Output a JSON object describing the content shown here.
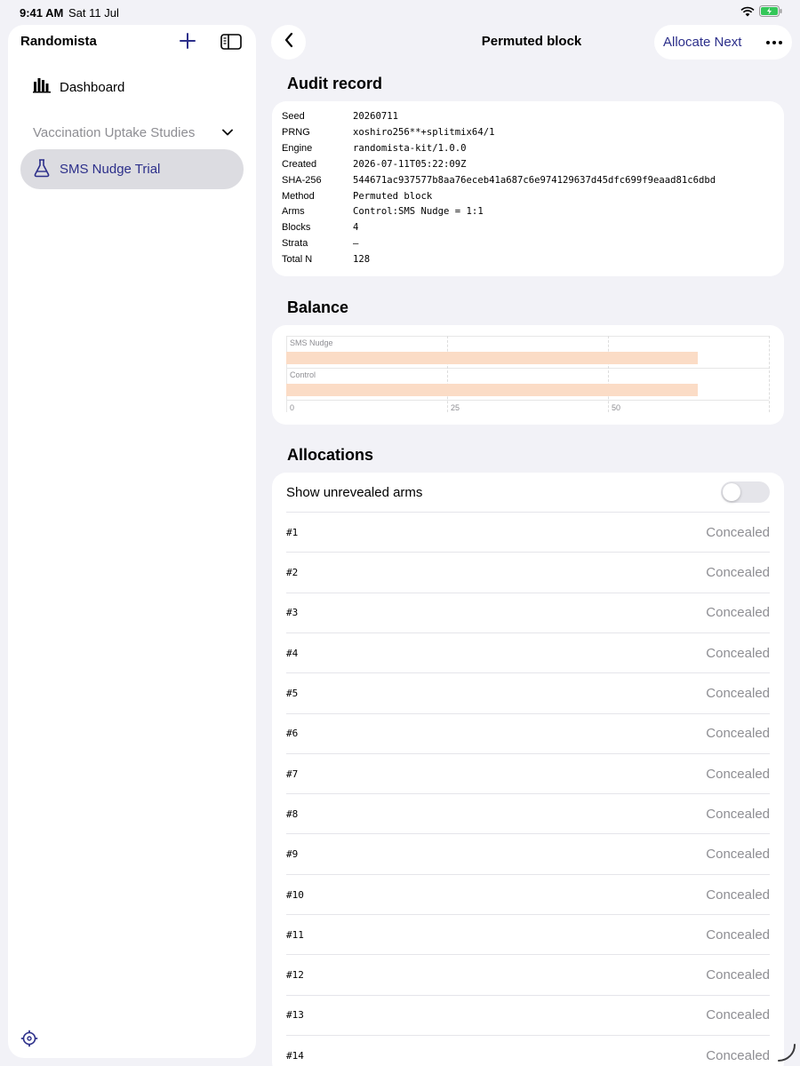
{
  "status_bar": {
    "time": "9:41 AM",
    "date": "Sat 11 Jul"
  },
  "sidebar": {
    "title": "Randomista",
    "nav": {
      "dashboard_label": "Dashboard"
    },
    "group": {
      "label": "Vaccination Uptake Studies"
    },
    "selected_item": {
      "label": "SMS Nudge Trial"
    }
  },
  "header": {
    "title": "Permuted block",
    "allocate_label": "Allocate Next"
  },
  "audit": {
    "section_title": "Audit record",
    "rows": [
      {
        "key": "Seed",
        "value": "20260711"
      },
      {
        "key": "PRNG",
        "value": "xoshiro256**+splitmix64/1"
      },
      {
        "key": "Engine",
        "value": "randomista-kit/1.0.0"
      },
      {
        "key": "Created",
        "value": "2026-07-11T05:22:09Z"
      },
      {
        "key": "SHA-256",
        "value": "544671ac937577b8aa76eceb41a687c6e974129637d45dfc699f9eaad81c6dbd"
      },
      {
        "key": "Method",
        "value": "Permuted block"
      },
      {
        "key": "Arms",
        "value": "Control:SMS Nudge = 1:1"
      },
      {
        "key": "Blocks",
        "value": "4"
      },
      {
        "key": "Strata",
        "value": "—"
      },
      {
        "key": "Total N",
        "value": "128"
      }
    ]
  },
  "balance": {
    "section_title": "Balance",
    "chart_data": {
      "type": "bar",
      "orientation": "horizontal",
      "categories": [
        "SMS Nudge",
        "Control"
      ],
      "values": [
        64,
        64
      ],
      "xticks": [
        "0",
        "25",
        "50"
      ],
      "xlim": [
        0,
        75
      ],
      "grid": true,
      "color": "#fbdcc6"
    }
  },
  "allocations": {
    "section_title": "Allocations",
    "toggle_label": "Show unrevealed arms",
    "toggle_on": false,
    "items": [
      {
        "id": "#1",
        "status": "Concealed"
      },
      {
        "id": "#2",
        "status": "Concealed"
      },
      {
        "id": "#3",
        "status": "Concealed"
      },
      {
        "id": "#4",
        "status": "Concealed"
      },
      {
        "id": "#5",
        "status": "Concealed"
      },
      {
        "id": "#6",
        "status": "Concealed"
      },
      {
        "id": "#7",
        "status": "Concealed"
      },
      {
        "id": "#8",
        "status": "Concealed"
      },
      {
        "id": "#9",
        "status": "Concealed"
      },
      {
        "id": "#10",
        "status": "Concealed"
      },
      {
        "id": "#11",
        "status": "Concealed"
      },
      {
        "id": "#12",
        "status": "Concealed"
      },
      {
        "id": "#13",
        "status": "Concealed"
      },
      {
        "id": "#14",
        "status": "Concealed"
      }
    ]
  },
  "icons": {
    "add": "plus-icon",
    "sidebar_toggle": "sidebar-toggle-icon",
    "dashboard": "bar-chart-icon",
    "group_chevron": "chevron-down-icon",
    "trial": "flask-icon",
    "settings": "gear-icon",
    "back": "chevron-left-icon",
    "more": "ellipsis-icon",
    "wifi": "wifi-icon",
    "battery": "battery-charging-icon"
  },
  "colors": {
    "accent": "#2c2f8a",
    "bar": "#fbdcc6",
    "battery": "#34c759"
  }
}
